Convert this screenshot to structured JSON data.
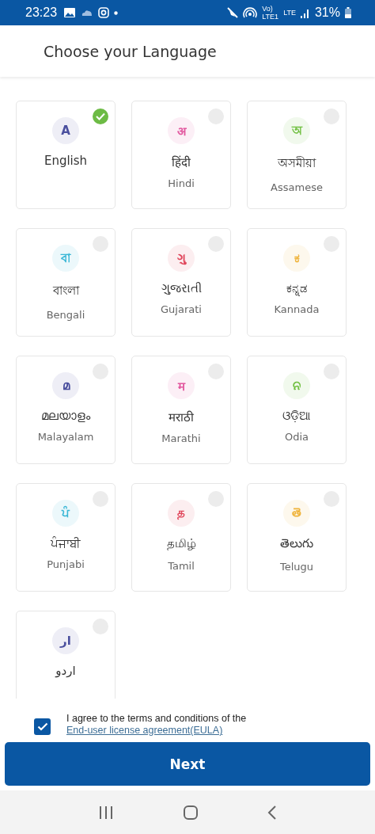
{
  "status_bar": {
    "time": "23:23",
    "volte_top": "Vo)",
    "volte_bottom": "LTE1",
    "network": "LTE",
    "battery": "31%"
  },
  "header": {
    "title": "Choose your Language"
  },
  "languages": [
    {
      "glyph": "A",
      "native": "English",
      "selected": true,
      "color": "#4a4f9e"
    },
    {
      "glyph": "अ",
      "native": "हिंदी",
      "english": "Hindi",
      "selected": false,
      "color": "#e2589f"
    },
    {
      "glyph": "অ",
      "native": "অসমীয়া",
      "english": "Assamese",
      "selected": false,
      "color": "#6fbf3f"
    },
    {
      "glyph": "বা",
      "native": "বাংলা",
      "english": "Bengali",
      "selected": false,
      "color": "#3ab7d6"
    },
    {
      "glyph": "ગુ",
      "native": "ગુજરાતી",
      "english": "Gujarati",
      "selected": false,
      "color": "#e0475c"
    },
    {
      "glyph": "ಕ",
      "native": "ಕನ್ನಡ",
      "english": "Kannada",
      "selected": false,
      "color": "#efb43d"
    },
    {
      "glyph": "മ",
      "native": "മലയാളം",
      "english": "Malayalam",
      "selected": false,
      "color": "#4a4f9e"
    },
    {
      "glyph": "म",
      "native": "मराठी",
      "english": "Marathi",
      "selected": false,
      "color": "#e2589f"
    },
    {
      "glyph": "ନ",
      "native": "ଓଡ଼ିଆ",
      "english": "Odia",
      "selected": false,
      "color": "#6fbf3f"
    },
    {
      "glyph": "ਪੰ",
      "native": "ਪੰਜਾਬੀ",
      "english": "Punjabi",
      "selected": false,
      "color": "#3ab7d6"
    },
    {
      "glyph": "த",
      "native": "தமிழ்",
      "english": "Tamil",
      "selected": false,
      "color": "#e0475c"
    },
    {
      "glyph": "తె",
      "native": "తెలుగు",
      "english": "Telugu",
      "selected": false,
      "color": "#efb43d"
    },
    {
      "glyph": "ار",
      "native": "اردو",
      "selected": false,
      "color": "#4a4f9e"
    }
  ],
  "agreement": {
    "checked": true,
    "text": "I agree to the terms and conditions of the",
    "link": "End-user license agreement(EULA)"
  },
  "next_button": {
    "label": "Next"
  }
}
